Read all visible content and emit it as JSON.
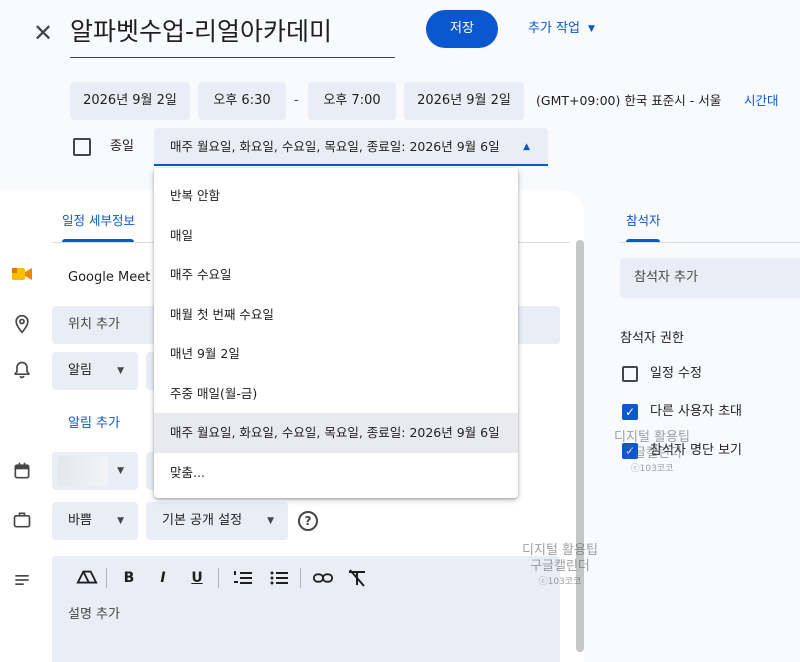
{
  "header": {
    "title": "알파벳수업-리얼아카데미",
    "save_label": "저장",
    "more_actions_label": "추가 작업"
  },
  "datetime": {
    "start_date": "2026년 9월 2일",
    "start_time": "오후 6:30",
    "separator": "-",
    "end_time": "오후 7:00",
    "end_date": "2026년 9월 2일",
    "timezone": "(GMT+09:00) 한국 표준시 - 서울",
    "timezone_link": "시간대"
  },
  "allday": {
    "label": "종일",
    "checked": false
  },
  "repeat": {
    "selected": "매주 월요일, 화요일, 수요일, 목요일, 종료일: 2026년 9월 6일",
    "options": [
      "반복 안함",
      "매일",
      "매주 수요일",
      "매월 첫 번째 수요일",
      "매년 9월 2일",
      "주중 매일(월-금)",
      "매주 월요일, 화요일, 수요일, 목요일, 종료일: 2026년 9월 6일",
      "맞춤..."
    ],
    "highlighted_index": 6
  },
  "details": {
    "tab_label": "일정 세부정보",
    "meet_label": "Google Meet …",
    "location_placeholder": "위치 추가",
    "notification_label": "알림",
    "add_notification": "알림 추가",
    "busy_label": "바쁨",
    "visibility_label": "기본 공개 설정",
    "description_placeholder": "설명 추가"
  },
  "toolbar": {
    "drive_icon": "drive-icon",
    "bold": "B",
    "italic": "I",
    "underline": "U",
    "numbered_list_icon": "numbered-list-icon",
    "bulleted_list_icon": "bulleted-list-icon",
    "link_icon": "link-icon",
    "clear_format_icon": "clear-format-icon"
  },
  "guests": {
    "tab_label": "참석자",
    "add_placeholder": "참석자 추가",
    "permissions_title": "참석자 권한",
    "permissions": [
      {
        "label": "일정 수정",
        "checked": false
      },
      {
        "label": "다른 사용자 초대",
        "checked": true
      },
      {
        "label": "참석자 명단 보기",
        "checked": true
      }
    ]
  },
  "watermarks": [
    {
      "line1": "디지털 활용팁",
      "line2": "구글캘린더",
      "line3": "ⓒ103코코"
    },
    {
      "line1": "디지털 활용팁",
      "line2": "구글캘린더",
      "line3": "ⓒ103코코"
    }
  ],
  "colors": {
    "accent": "#0b57d0",
    "field_bg": "#e9eef6",
    "page_bg": "#f8fafd",
    "meet_yellow": "#fbbc04"
  }
}
